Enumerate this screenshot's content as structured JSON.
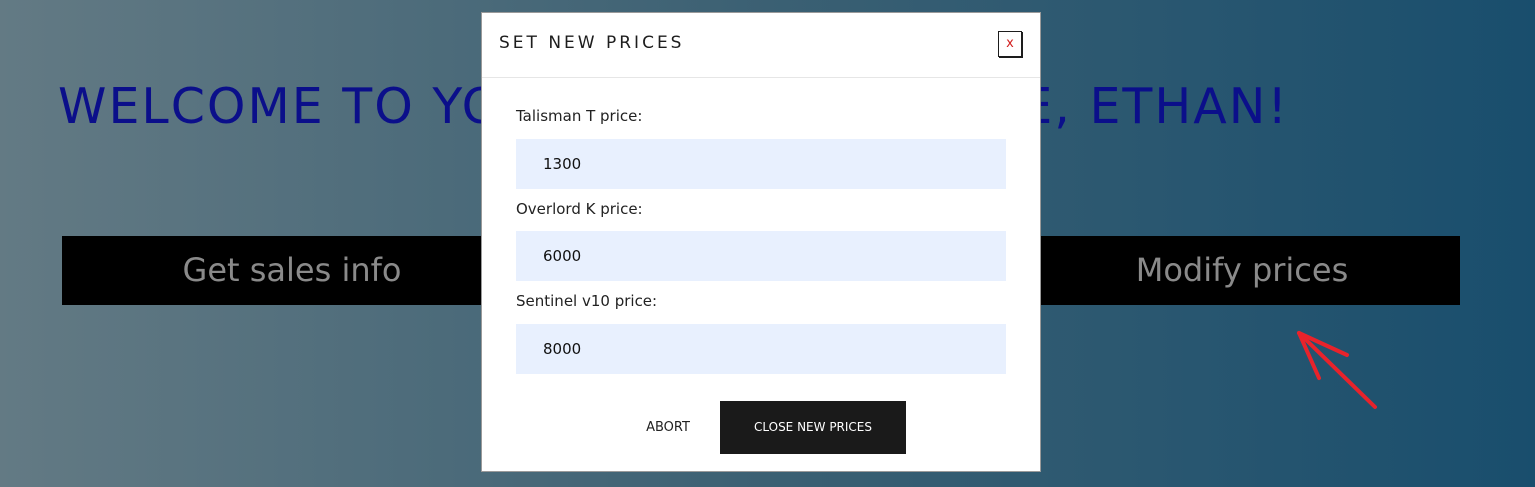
{
  "page": {
    "welcome_text": "WELCOME TO YOUR PERSONAL SPACE, ETHAN!"
  },
  "actions": {
    "sales_label": "Get sales info",
    "modify_label": "Modify prices"
  },
  "modal": {
    "title": "SET NEW PRICES",
    "close_label": "x",
    "fields": [
      {
        "label": "Talisman T price:",
        "value": "1300"
      },
      {
        "label": "Overlord K price:",
        "value": "6000"
      },
      {
        "label": "Sentinel v10 price:",
        "value": "8000"
      }
    ],
    "abort_label": "ABORT",
    "submit_label": "CLOSE NEW PRICES"
  },
  "colors": {
    "welcome": "#0b0f8a",
    "action_bar": "#000000",
    "input_bg": "#e8f0fe",
    "close_x": "#d21e1e",
    "arrow": "#e8232b"
  }
}
